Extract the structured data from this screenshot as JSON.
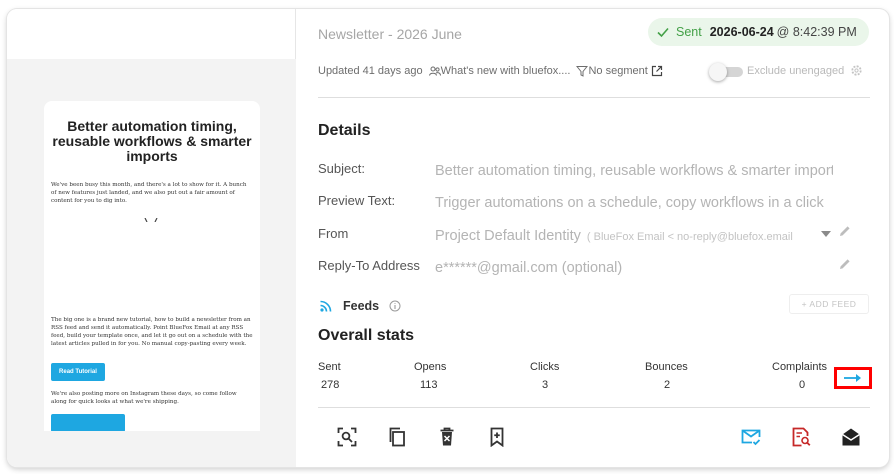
{
  "preview": {
    "headline": "Better automation timing, reusable workflows & smarter imports",
    "paragraph1": "We've been busy this month, and there's a lot to show for it. A bunch of new features just landed, and we also put out a fair amount of content for you to dig into.",
    "paragraph2": "The big one is a brand new tutorial, how to build a newsletter from an RSS feed and send it automatically. Point BlueFox Email at any RSS feed, build your template once, and let it go out on a schedule with the latest articles pulled in for you. No manual copy-pasting every week.",
    "button_label": "Read Tutorial",
    "paragraph3": "We're also posting more on Instagram these days, so come follow along for quick looks at what we're shipping."
  },
  "header": {
    "title": "Newsletter - 2026 June",
    "status_label": "Sent",
    "status_date": "2026-06-24",
    "status_time": "@ 8:42:39 PM"
  },
  "meta": {
    "updated": "Updated 41 days ago",
    "audience": "What's new with bluefox....",
    "segment": "No segment",
    "exclude_label": "Exclude unengaged"
  },
  "details": {
    "heading": "Details",
    "subject_label": "Subject:",
    "subject_value": "Better automation timing, reusable workflows & smarter imports",
    "preview_label": "Preview Text:",
    "preview_value": "Trigger automations on a schedule, copy workflows in a click",
    "from_label": "From",
    "from_value": "Project Default Identity",
    "from_sub": "( BlueFox Email < no-reply@bluefox.email",
    "reply_label": "Reply-To Address",
    "reply_value": "e******@gmail.com (optional)"
  },
  "feeds": {
    "label": "Feeds",
    "add_label": "+ ADD FEED"
  },
  "stats": {
    "heading": "Overall stats",
    "items": [
      {
        "label": "Sent",
        "value": "278"
      },
      {
        "label": "Opens",
        "value": "113"
      },
      {
        "label": "Clicks",
        "value": "3"
      },
      {
        "label": "Bounces",
        "value": "2"
      },
      {
        "label": "Complaints",
        "value": "0"
      }
    ]
  },
  "colors": {
    "accent": "#1ea7e1",
    "sent_green": "#43a047",
    "danger": "#c62828",
    "highlight": "#ff0000"
  },
  "icons": {
    "preview_toolbar": [
      "zoom-scan-icon",
      "copy-icon",
      "delete-icon",
      "bookmark-add-icon"
    ],
    "send_toolbar": [
      "mark-email-read-icon",
      "report-search-icon",
      "drafts-icon"
    ]
  }
}
